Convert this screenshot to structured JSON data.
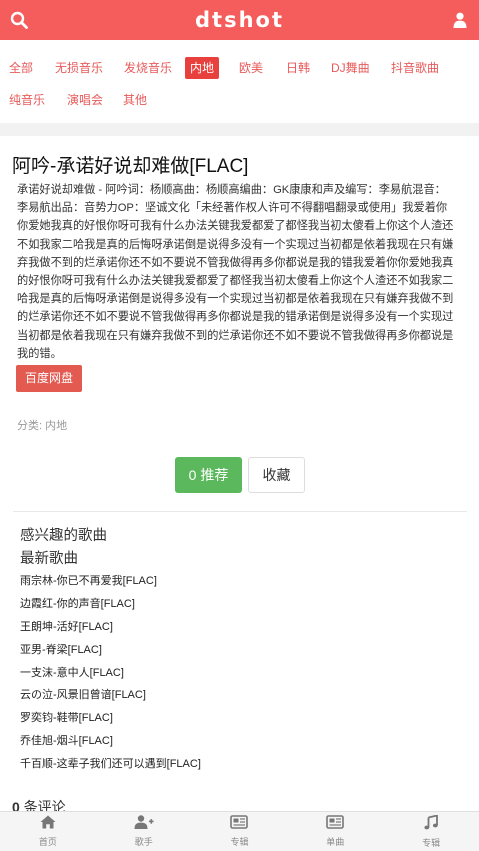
{
  "header": {
    "logo": "dtshot",
    "search_icon": "search-icon",
    "user_icon": "user-icon",
    "accent": "#f55c5c"
  },
  "categories": [
    "全部",
    "无损音乐",
    "发烧音乐",
    "内地",
    "欧美",
    "日韩",
    "DJ舞曲",
    "抖音歌曲",
    "纯音乐",
    "演唱会",
    "其他"
  ],
  "active_category": "内地",
  "song": {
    "title": "阿吟-承诺好说却难做[FLAC]",
    "description": "承诺好说却难做 - 阿吟词：杨顺高曲：杨顺高编曲：GK康康和声及编写：李易航混音：李易航出品：音势力OP：坚诚文化「未经著作权人许可不得翻唱翻录或使用」我爱着你你爱她我真的好恨你呀可我有什么办法关键我爱都爱了都怪我当初太傻看上你这个人渣还不如我家二哈我是真的后悔呀承诺倒是说得多没有一个实现过当初都是依着我现在只有嫌弃我做不到的烂承诺你还不如不要说不管我做得再多你都说是我的错我爱着你你爱她我真的好恨你呀可我有什么办法关键我爱都爱了都怪我当初太傻看上你这个人渣还不如我家二哈我是真的后悔呀承诺倒是说得多没有一个实现过当初都是依着我现在只有嫌弃我做不到的烂承诺你还不如不要说不管我做得再多你都说是我的错承诺倒是说得多没有一个实现过当初都是依着我现在只有嫌弃我做不到的烂承诺你还不如不要说不管我做得再多你都说是我的错。",
    "pan_button": "百度网盘",
    "category_label": "分类: 内地",
    "recommend_count": "0",
    "recommend_label": "推荐",
    "favorite_label": "收藏"
  },
  "sections": {
    "interested": "感兴趣的歌曲",
    "latest": "最新歌曲"
  },
  "latest_songs": [
    "雨宗林-你已不再爱我[FLAC]",
    "边霞红-你的声音[FLAC]",
    "王朗坤-活好[FLAC]",
    "亚男-脊梁[FLAC]",
    "一支沫-意中人[FLAC]",
    "云の泣-风景旧曾谙[FLAC]",
    "罗奕钧-鞋带[FLAC]",
    "乔佳旭-烟斗[FLAC]",
    "千百顺-这辈子我们还可以遇到[FLAC]"
  ],
  "comments": {
    "count": "0",
    "label": "条评论"
  },
  "bottom_nav": [
    {
      "label": "首页",
      "icon": "home-icon"
    },
    {
      "label": "歌手",
      "icon": "add-user-icon"
    },
    {
      "label": "专辑",
      "icon": "newspaper-icon"
    },
    {
      "label": "单曲",
      "icon": "newspaper-icon"
    },
    {
      "label": "专辑",
      "icon": "music-note-icon"
    }
  ]
}
